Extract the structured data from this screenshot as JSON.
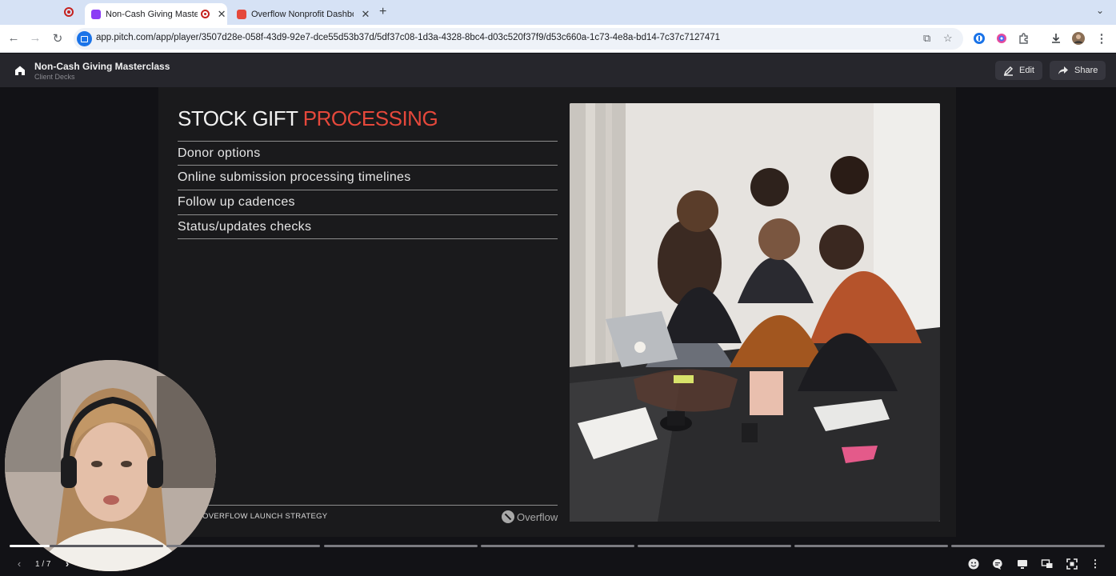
{
  "browser": {
    "tabs": [
      {
        "title": "Non-Cash Giving Masterclass",
        "active": true,
        "favicon_color": "#8b3cf5"
      },
      {
        "title": "Overflow Nonprofit Dashboard",
        "active": false,
        "favicon_color": "#e5483b"
      }
    ],
    "url": "app.pitch.com/app/player/3507d28e-058f-43d9-92e7-dce55d53b37d/5df37c08-1d3a-4328-8bc4-d03c520f37f9/d53c660a-1c73-4e8a-bd14-7c37c7127471"
  },
  "header": {
    "title": "Non-Cash Giving Masterclass",
    "subtitle": "Client Decks",
    "edit_label": "Edit",
    "share_label": "Share"
  },
  "slide": {
    "title_main": "STOCK GIFT ",
    "title_accent": "PROCESSING",
    "bullets": [
      "Donor options",
      "Online submission processing timelines",
      "Follow up cadences",
      "Status/updates checks"
    ],
    "footer": "OVERFLOW LAUNCH STRATEGY",
    "logo": "Overflow"
  },
  "player": {
    "counter": "1 / 7",
    "current_slide": 1,
    "total_slides": 7
  },
  "colors": {
    "accent": "#e5483b",
    "slide_bg": "#1a1a1c",
    "stage_bg": "#121216"
  }
}
